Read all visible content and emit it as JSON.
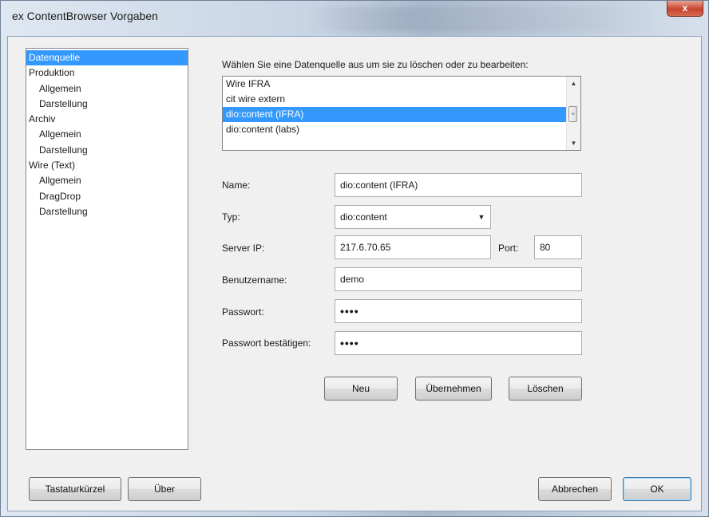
{
  "window": {
    "title": "ex ContentBrowser Vorgaben",
    "close_symbol": "x"
  },
  "tree": [
    {
      "label": "Datenquelle",
      "level": 1,
      "selected": true
    },
    {
      "label": "Produktion",
      "level": 1
    },
    {
      "label": "Allgemein",
      "level": 2
    },
    {
      "label": "Darstellung",
      "level": 2
    },
    {
      "label": "Archiv",
      "level": 1
    },
    {
      "label": "Allgemein",
      "level": 2
    },
    {
      "label": "Darstellung",
      "level": 2
    },
    {
      "label": "Wire (Text)",
      "level": 1
    },
    {
      "label": "Allgemein",
      "level": 2
    },
    {
      "label": "DragDrop",
      "level": 2
    },
    {
      "label": "Darstellung",
      "level": 2
    }
  ],
  "datasource": {
    "instruction": "Wählen Sie eine Datenquelle aus um sie zu löschen oder zu bearbeiten:",
    "items": [
      {
        "label": "Wire IFRA"
      },
      {
        "label": "cit wire extern"
      },
      {
        "label": "dio:content (IFRA)",
        "selected": true
      },
      {
        "label": "dio:content (labs)"
      }
    ],
    "scroll_up_icon": "▲",
    "scroll_down_icon": "▼",
    "scroll_thumb_grip": "≡"
  },
  "form": {
    "name_label": "Name:",
    "name_value": "dio:content (IFRA)",
    "typ_label": "Typ:",
    "typ_value": "dio:content",
    "typ_arrow": "▼",
    "server_label": "Server IP:",
    "server_value": "217.6.70.65",
    "port_label": "Port:",
    "port_value": "80",
    "user_label": "Benutzername:",
    "user_value": "demo",
    "pwd_label": "Passwort:",
    "pwd_value": "••••",
    "pwd_confirm_label": "Passwort bestätigen:",
    "pwd_confirm_value": "••••"
  },
  "actions": {
    "new": "Neu",
    "apply": "Übernehmen",
    "delete": "Löschen"
  },
  "footer": {
    "shortcuts": "Tastaturkürzel",
    "about": "Über",
    "cancel": "Abbrechen",
    "ok": "OK"
  }
}
